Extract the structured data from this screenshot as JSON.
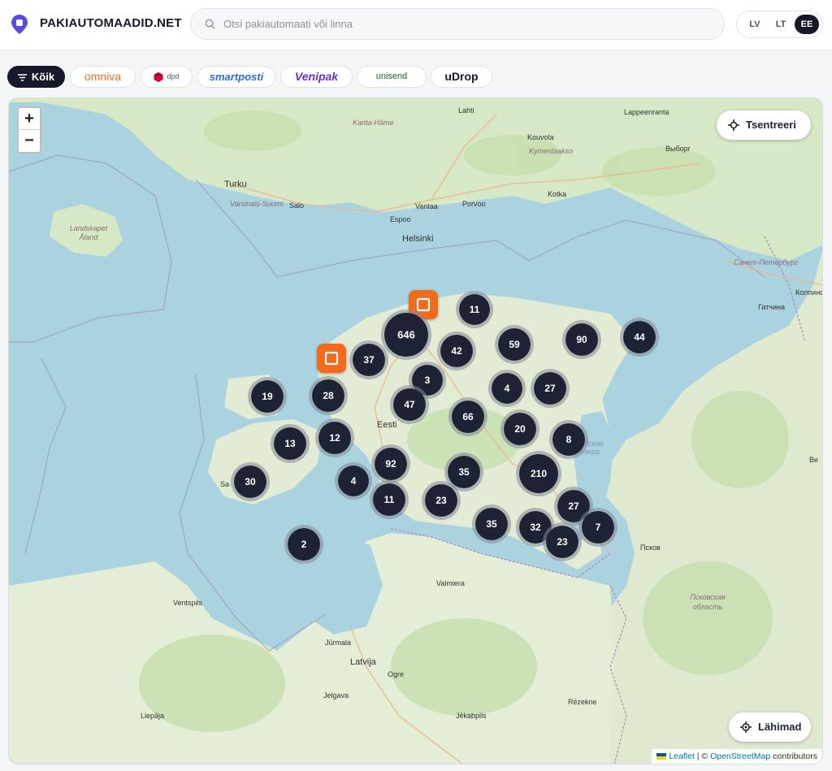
{
  "header": {
    "brand": "PAKIAUTOMAADID.NET",
    "logo_icon": "map-pin-logo-icon",
    "search_placeholder": "Otsi pakiautomaati või linna",
    "search_value": "",
    "languages": [
      {
        "label": "LV",
        "active": false
      },
      {
        "label": "LT",
        "active": false
      },
      {
        "label": "EE",
        "active": true
      }
    ]
  },
  "filters": [
    {
      "label": "Kõik",
      "active": true,
      "icon": "filter-icon"
    },
    {
      "label": "omniva",
      "color": "#f26b1d"
    },
    {
      "label": "dpd",
      "color": "#dc0032",
      "icon": "dpd-cube-icon"
    },
    {
      "label": "smartposti",
      "color": "#2e6bd9"
    },
    {
      "label": "Venipak",
      "color": "#6a2fc3"
    },
    {
      "label": "unisend",
      "color": "#1f5a2e"
    },
    {
      "label": "uDrop",
      "color": "#15192a"
    }
  ],
  "map": {
    "zoom_in": "+",
    "zoom_out": "−",
    "center_button": "Tsentreeri",
    "center_icon": "crosshair-icon",
    "nearby_button": "Lähimad",
    "nearby_icon": "locate-icon",
    "attribution": {
      "leaflet": "Leaflet",
      "sep": " | © ",
      "osm": "OpenStreetMap",
      "rest": " contributors"
    },
    "clusters": [
      "11",
      "646",
      "42",
      "59",
      "90",
      "44",
      "37",
      "3",
      "4",
      "27",
      "47",
      "66",
      "20",
      "8",
      "19",
      "28",
      "13",
      "12",
      "92",
      "35",
      "210",
      "30",
      "4",
      "11",
      "23",
      "27",
      "35",
      "32",
      "7",
      "23",
      "2"
    ],
    "omniva_pins": 2,
    "places": [
      "Lahti",
      "Lappeenranta",
      "Kanta-Häme",
      "Kouvola",
      "Kymenlaakso",
      "Выборг",
      "Turku",
      "Varsinais-Suomi",
      "Salo",
      "Vantaa",
      "Porvoo",
      "Kotka",
      "Espoo",
      "Helsinki",
      "Landskapet Åland",
      "Санкт-Петербург",
      "Колпино",
      "Гатчина",
      "Eesti",
      "Ventspils",
      "Jūrmala",
      "Latvija",
      "Ogre",
      "Valmiera",
      "Псков",
      "Псковская область",
      "Jelgava",
      "Liepāja",
      "Rēzekne",
      "Jēkabpils",
      "Sa",
      "Ве",
      "Чудское озеро"
    ]
  }
}
